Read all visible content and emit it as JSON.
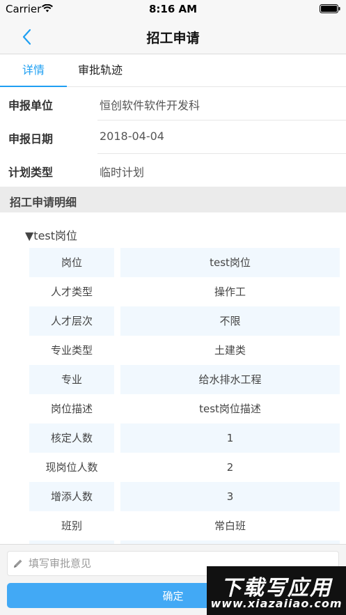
{
  "status_bar": {
    "carrier": "Carrier",
    "time": "8:16 AM",
    "icons": [
      "wifi-icon",
      "battery-icon"
    ]
  },
  "nav": {
    "title": "招工申请",
    "back_icon": "chevron-left-icon"
  },
  "tabs": [
    {
      "label": "详情",
      "active": true
    },
    {
      "label": "审批轨迹",
      "active": false
    }
  ],
  "info": [
    {
      "label": "申报单位",
      "value": "恒创软件软件开发科"
    },
    {
      "label": "申报日期",
      "value": "2018-04-04"
    },
    {
      "label": "计划类型",
      "value": "临时计划"
    }
  ],
  "section": {
    "title": "招工申请明细"
  },
  "group": {
    "title": "▼test岗位"
  },
  "details": [
    {
      "key": "岗位",
      "value": "test岗位"
    },
    {
      "key": "人才类型",
      "value": "操作工"
    },
    {
      "key": "人才层次",
      "value": "不限"
    },
    {
      "key": "专业类型",
      "value": "土建类"
    },
    {
      "key": "专业",
      "value": "给水排水工程"
    },
    {
      "key": "岗位描述",
      "value": "test岗位描述"
    },
    {
      "key": "核定人数",
      "value": "1"
    },
    {
      "key": "现岗位人数",
      "value": "2"
    },
    {
      "key": "增添人数",
      "value": "3"
    },
    {
      "key": "班别",
      "value": "常白班"
    },
    {
      "key": "",
      "value": ""
    }
  ],
  "bottom": {
    "opinion_placeholder": "填写审批意见",
    "opinion_value": "",
    "confirm_label": "确定",
    "pencil_icon": "pencil-icon"
  },
  "watermark": {
    "top": "下载写应用",
    "bottom": "www.xiazaiiao.com"
  },
  "colors": {
    "accent": "#1e9ff2",
    "button": "#42a9f5",
    "row_shade": "#f1f8fe",
    "section_bg": "#ebebeb"
  }
}
